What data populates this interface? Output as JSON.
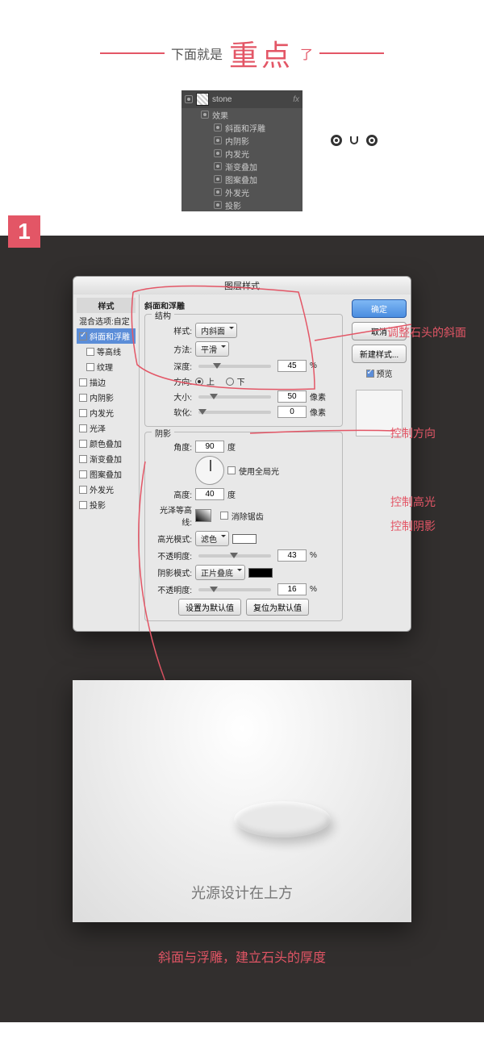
{
  "header": {
    "t1": "下面就是",
    "t2": "重点",
    "t3": "了"
  },
  "layers": {
    "name": "stone",
    "fx": "fx",
    "group": "效果",
    "items": [
      "斜面和浮雕",
      "内阴影",
      "内发光",
      "渐变叠加",
      "图案叠加",
      "外发光",
      "投影"
    ]
  },
  "badge": "1",
  "dialog": {
    "title": "图层样式",
    "left_hdr": "样式",
    "left_blend": "混合选项:自定",
    "left_items": [
      {
        "t": "斜面和浮雕",
        "on": true,
        "sel": true
      },
      {
        "t": "等高线",
        "on": false,
        "indent": true
      },
      {
        "t": "纹理",
        "on": false,
        "indent": true
      },
      {
        "t": "描边",
        "on": false
      },
      {
        "t": "内阴影",
        "on": false
      },
      {
        "t": "内发光",
        "on": false
      },
      {
        "t": "光泽",
        "on": false
      },
      {
        "t": "颜色叠加",
        "on": false
      },
      {
        "t": "渐变叠加",
        "on": false
      },
      {
        "t": "图案叠加",
        "on": false
      },
      {
        "t": "外发光",
        "on": false
      },
      {
        "t": "投影",
        "on": false
      }
    ],
    "section_title": "斜面和浮雕",
    "struct": {
      "title": "结构",
      "style_l": "样式:",
      "style_v": "内斜面",
      "method_l": "方法:",
      "method_v": "平滑",
      "depth_l": "深度:",
      "depth_v": "45",
      "pct": "%",
      "dir_l": "方向:",
      "up": "上",
      "down": "下",
      "size_l": "大小:",
      "size_v": "50",
      "px": "像素",
      "soft_l": "软化:",
      "soft_v": "0"
    },
    "shade": {
      "title": "阴影",
      "angle_l": "角度:",
      "angle_v": "90",
      "deg": "度",
      "global": "使用全局光",
      "alt_l": "高度:",
      "alt_v": "40",
      "gloss_l": "光泽等高线:",
      "aa": "消除锯齿",
      "hl_mode_l": "高光模式:",
      "hl_mode_v": "滤色",
      "hl_op_l": "不透明度:",
      "hl_op_v": "43",
      "sh_mode_l": "阴影模式:",
      "sh_mode_v": "正片叠底",
      "sh_op_l": "不透明度:",
      "sh_op_v": "16"
    },
    "btn_default": "设置为默认值",
    "btn_reset": "复位为默认值",
    "right": {
      "ok": "确定",
      "cancel": "取消",
      "new": "新建样式...",
      "preview": "预览"
    }
  },
  "anno": {
    "a1": "调整石头的斜面",
    "a2": "控制方向",
    "a3": "控制高光",
    "a4": "控制阴影"
  },
  "preview_cap": "光源设计在上方",
  "bottom": "斜面与浮雕，建立石头的厚度"
}
